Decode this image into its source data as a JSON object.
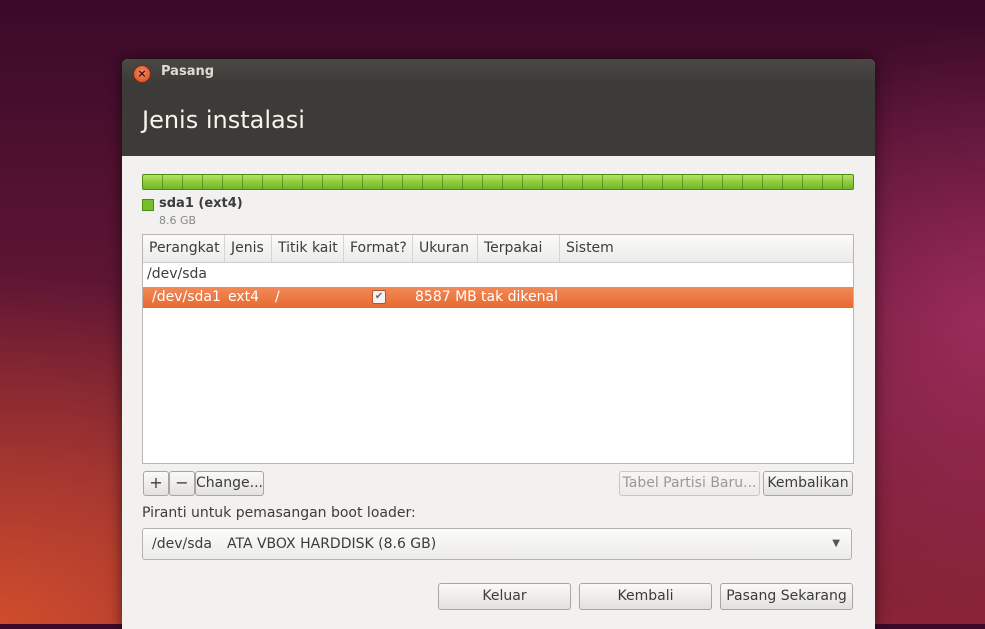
{
  "window": {
    "title": "Pasang",
    "page_title": "Jenis instalasi"
  },
  "partition_bar": {
    "legend_name": "sda1 (ext4)",
    "legend_size": "8.6 GB",
    "color": "#76bf2b"
  },
  "table": {
    "columns": [
      "Perangkat",
      "Jenis",
      "Titik kait",
      "Format?",
      "Ukuran",
      "Terpakai",
      "Sistem"
    ],
    "disk_row": {
      "device": "/dev/sda"
    },
    "selected_row": {
      "device": "/dev/sda1",
      "type": "ext4",
      "mount": "/",
      "format_checked": true,
      "size": "8587 MB",
      "used": "tak dikenal",
      "system": ""
    },
    "selection_color": "#e8692f"
  },
  "table_buttons": {
    "add": "+",
    "remove": "−",
    "change": "Change...",
    "new_table": "Tabel Partisi Baru...",
    "revert": "Kembalikan"
  },
  "bootloader": {
    "label": "Piranti untuk pemasangan boot loader:",
    "device": "/dev/sda",
    "description": "ATA VBOX HARDDISK (8.6 GB)"
  },
  "footer": {
    "quit": "Keluar",
    "back": "Kembali",
    "install": "Pasang Sekarang"
  },
  "icons": {
    "close": "close-icon",
    "dropdown": "chevron-down-icon",
    "check": "checkmark-icon"
  }
}
